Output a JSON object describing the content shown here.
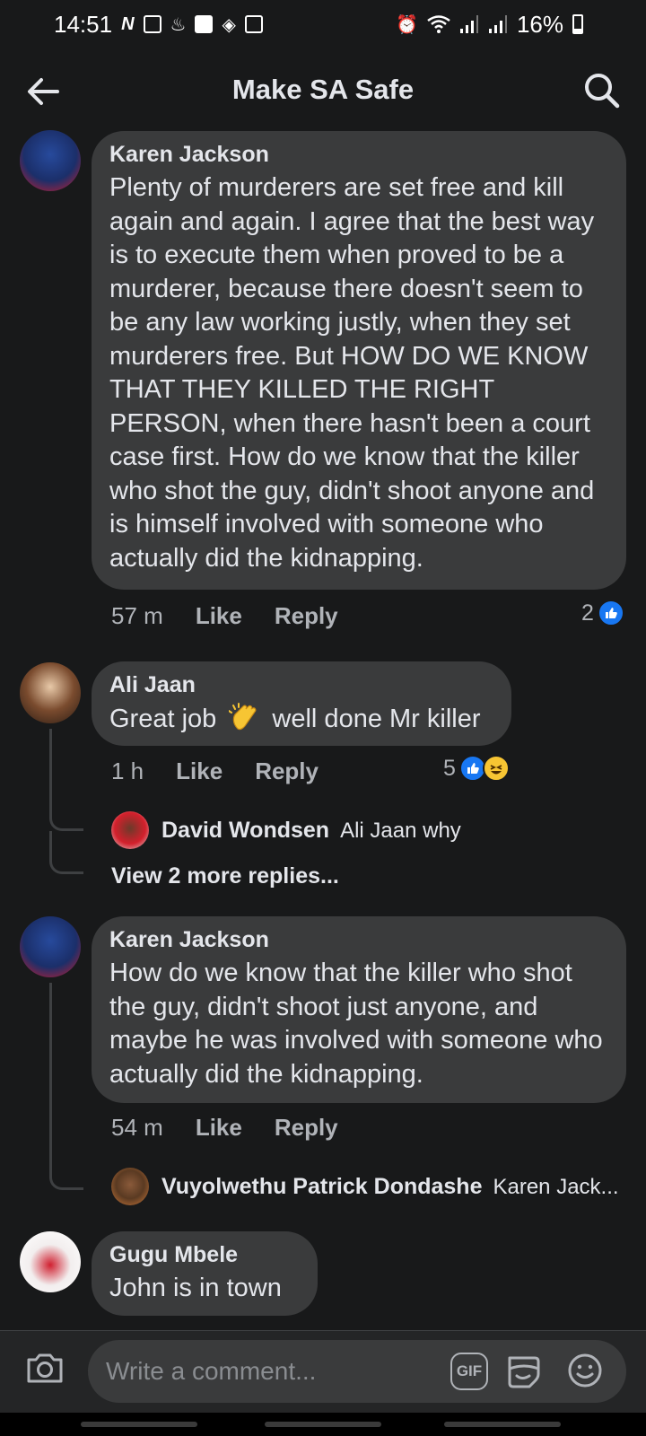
{
  "status_bar": {
    "time": "14:51",
    "battery": "16%",
    "icons": [
      "netflix-icon",
      "sim-icon",
      "notification-icon",
      "checkbox-icon",
      "shuffle-icon",
      "image-icon",
      "alarm-icon",
      "wifi-icon",
      "signal-icon",
      "signal-icon",
      "battery-icon"
    ]
  },
  "header": {
    "title": "Make SA Safe"
  },
  "comments": [
    {
      "author": "Karen Jackson",
      "text": "Plenty of murderers are set free and kill again and again. I agree that the best way is to execute them when proved to be a murderer, because there doesn't seem to be any law working justly, when they set murderers free. But HOW DO WE KNOW THAT THEY KILLED THE RIGHT PERSON, when there hasn't been a court case first. How do we know that the killer who shot the guy, didn't shoot anyone and is himself involved with someone who actually did the kidnapping.",
      "time": "57 m",
      "like_label": "Like",
      "reply_label": "Reply",
      "reaction_count": "2"
    },
    {
      "author": "Ali Jaan",
      "text_before": "Great job",
      "text_after": "well done Mr killer",
      "time": "1 h",
      "like_label": "Like",
      "reply_label": "Reply",
      "reaction_count": "5",
      "replies": {
        "preview_author": "David Wondsen",
        "preview_text": "Ali Jaan why",
        "view_more": "View 2 more replies..."
      }
    },
    {
      "author": "Karen Jackson",
      "text": "How do we know that the killer who shot the guy, didn't shoot just anyone, and maybe he was involved with someone who actually did the kidnapping.",
      "time": "54 m",
      "like_label": "Like",
      "reply_label": "Reply",
      "replies": {
        "preview_author": "Vuyolwethu Patrick Dondashe",
        "preview_text": "Karen Jack..."
      }
    },
    {
      "author": "Gugu Mbele",
      "text": "John is in town"
    }
  ],
  "composer": {
    "placeholder": "Write a comment...",
    "gif_label": "GIF"
  },
  "colors": {
    "background": "#18191a",
    "bubble": "#3a3b3c",
    "like_blue": "#1877f2",
    "haha_yellow": "#f7c533"
  }
}
